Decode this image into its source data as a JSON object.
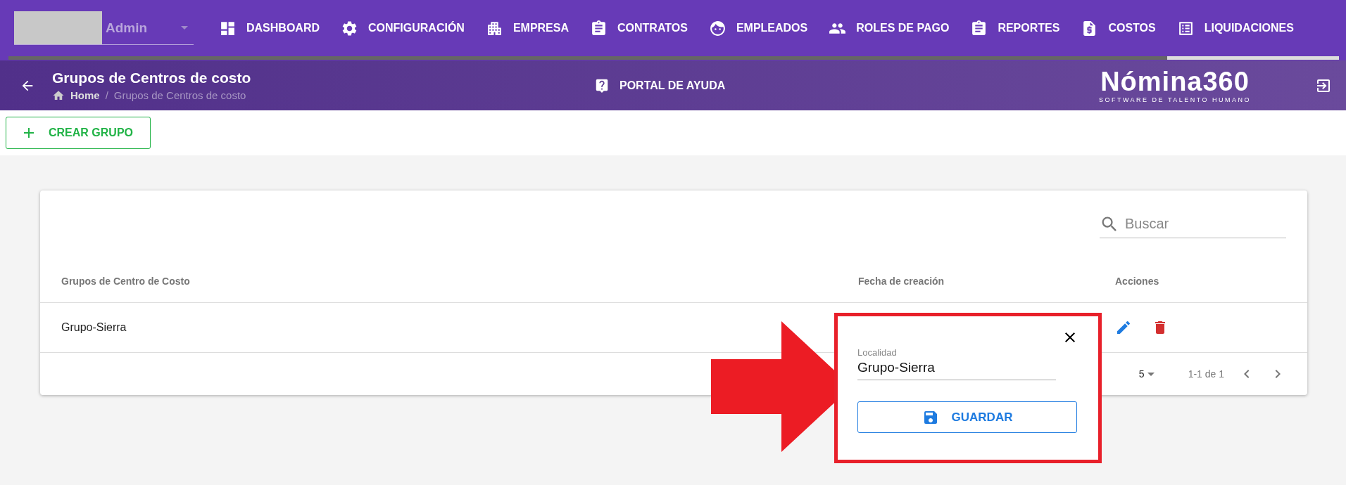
{
  "nav": {
    "user": "Admin",
    "items": [
      {
        "kind": "dashboard",
        "label": "DASHBOARD",
        "selected": false
      },
      {
        "kind": "settings",
        "label": "CONFIGURACIÓN",
        "selected": false
      },
      {
        "kind": "building",
        "label": "EMPRESA",
        "selected": false
      },
      {
        "kind": "clipboard",
        "label": "CONTRATOS",
        "selected": false
      },
      {
        "kind": "face",
        "label": "EMPLEADOS",
        "selected": false
      },
      {
        "kind": "people",
        "label": "ROLES DE PAGO",
        "selected": false
      },
      {
        "kind": "clipboard",
        "label": "REPORTES",
        "selected": false
      },
      {
        "kind": "invoice",
        "label": "COSTOS",
        "selected": false
      },
      {
        "kind": "list",
        "label": "LIQUIDACIONES",
        "selected": true
      }
    ]
  },
  "header": {
    "title": "Grupos de Centros de costo",
    "breadcrumb": [
      "Home",
      "Grupos de Centros de costo"
    ],
    "breadcrumb_separator": "/",
    "help": "PORTAL DE AYUDA",
    "logo": "Nómina360",
    "logo_tagline": "SOFTWARE DE TALENTO HUMANO"
  },
  "toolbar": {
    "create_button": "CREAR GRUPO"
  },
  "table": {
    "search": {
      "placeholder": "Buscar"
    },
    "columns": [
      "Grupos de Centro de Costo",
      "Fecha de creación",
      "Acciones"
    ],
    "rows": [
      {
        "name": "Grupo-Sierra"
      }
    ],
    "pagination": {
      "rows_per_page": "5",
      "range": "1-1 de 1"
    }
  },
  "popup": {
    "field": {
      "label": "Localidad",
      "value": "Grupo-Sierra"
    },
    "save_button": "GUARDAR"
  }
}
